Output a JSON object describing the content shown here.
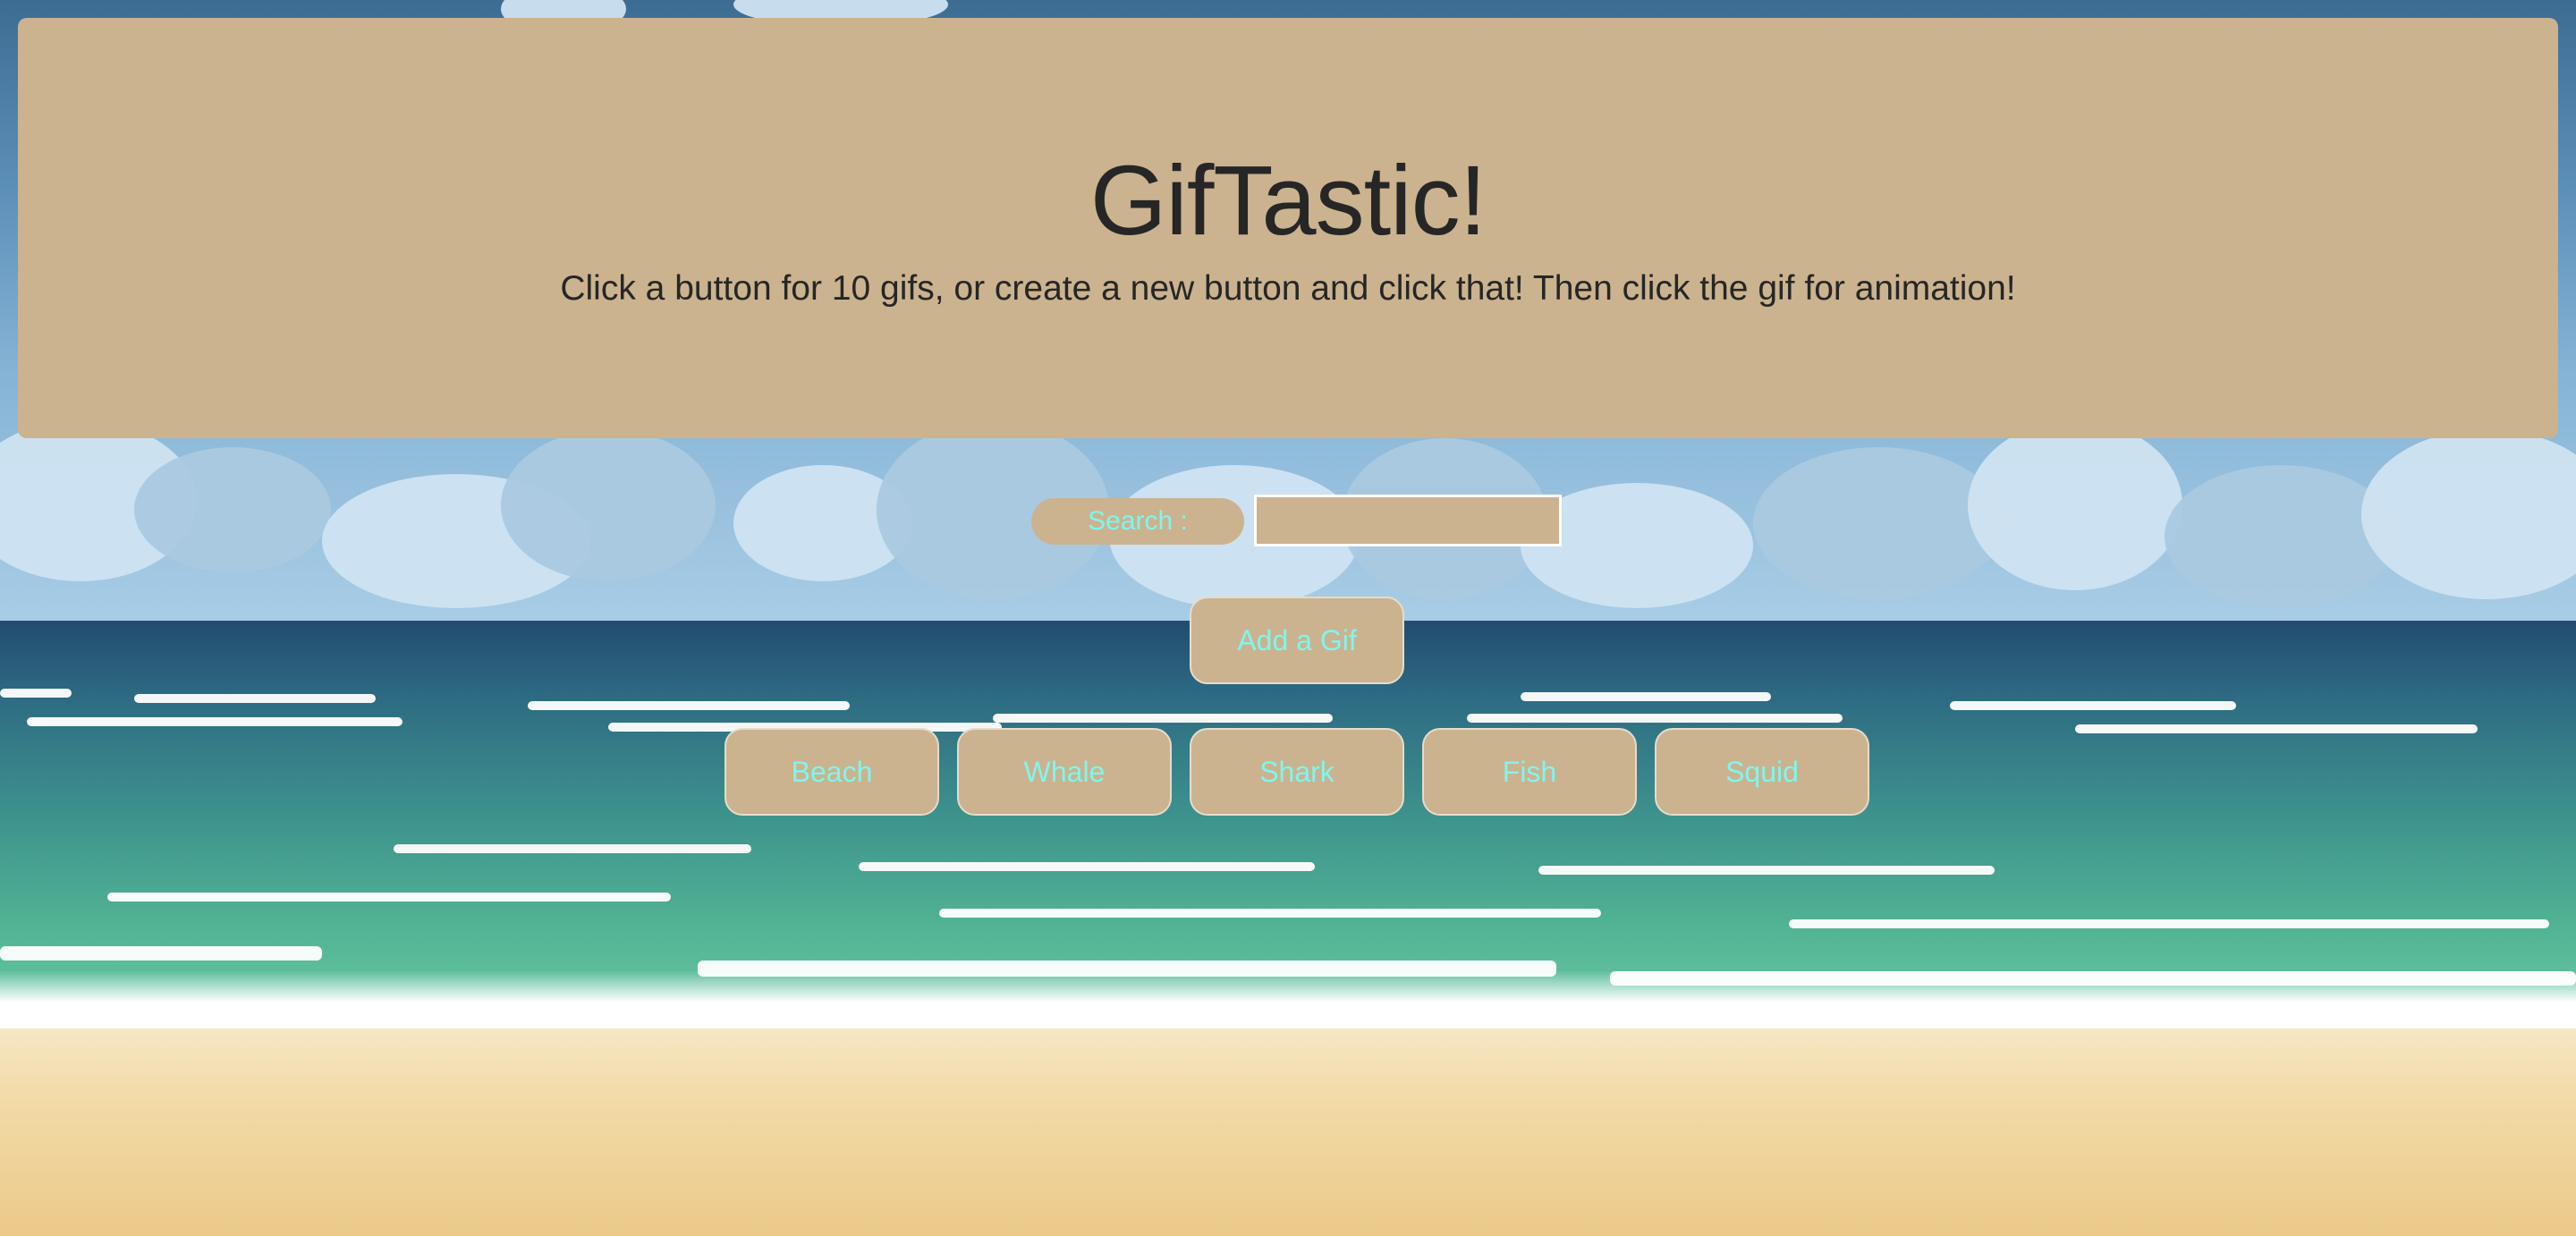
{
  "header": {
    "title": "GifTastic!",
    "subtitle": "Click a button for 10 gifs, or create a new button and click that! Then click the gif for animation!"
  },
  "search": {
    "label": "Search :",
    "value": "",
    "placeholder": ""
  },
  "add_button": {
    "label": "Add a Gif"
  },
  "topics": [
    {
      "label": "Beach"
    },
    {
      "label": "Whale"
    },
    {
      "label": "Shark"
    },
    {
      "label": "Fish"
    },
    {
      "label": "Squid"
    }
  ],
  "colors": {
    "panel": "#cbb38f",
    "button_text": "#7ff6ee",
    "heading_text": "#262626"
  }
}
